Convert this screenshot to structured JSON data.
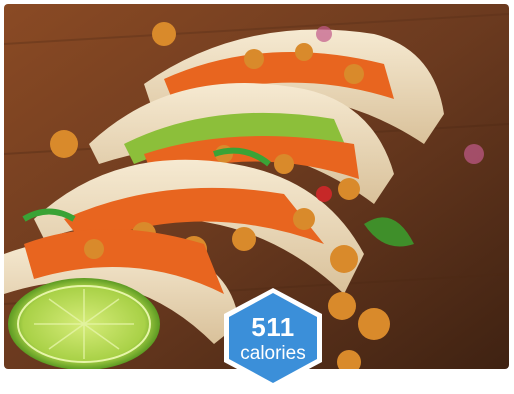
{
  "image": {
    "subject": "tacos",
    "colors": {
      "wood": "#6b3a1f",
      "tortilla": "#f0e0c4",
      "sweet_potato": "#e8651f",
      "chickpea": "#d98a2b",
      "avocado": "#8cbf3a",
      "lime": "#b5d94a",
      "onion": "#c25a8a"
    }
  },
  "badge": {
    "value": "511",
    "unit": "calories",
    "color": "#3b8fd9",
    "border_color": "#ffffff"
  }
}
